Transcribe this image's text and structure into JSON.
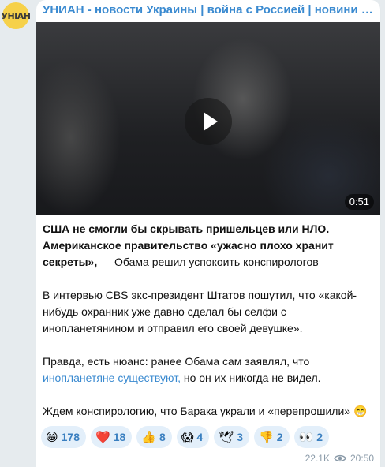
{
  "channel": {
    "title": "УНИАН - новости Украины | война с Россией | новини України...",
    "avatar_text": "УНІАН",
    "accent": "#3a8ad0"
  },
  "video": {
    "duration": "0:51"
  },
  "post": {
    "p1_bold": "США не смогли бы скрывать пришельцев или НЛО. Американское правительство «ужасно плохо хранит секреты»,",
    "p1_rest": " — Обама решил успокоить конспирологов",
    "p2": "В интервью CBS экс-президент Штатов пошутил, что «какой-нибудь охранник уже давно сделал бы селфи с инопланетянином и отправил его своей девушке».",
    "p3_start": "Правда, есть нюанс: ранее Обама сам заявлял, что ",
    "p3_link": "инопланетяне существуют,",
    "p3_end": " но он их никогда не видел.",
    "p4": "Ждем конспирологию, что Барака украли и «перепрошили» 😁"
  },
  "reactions": [
    {
      "icon": "grin-emoji",
      "emoji": "😁",
      "count": "178"
    },
    {
      "icon": "heart-emoji",
      "emoji": "❤️",
      "count": "18"
    },
    {
      "icon": "thumbs-up-emoji",
      "emoji": "👍",
      "count": "8"
    },
    {
      "icon": "scream-emoji",
      "emoji": "😱",
      "count": "4"
    },
    {
      "icon": "dove-emoji",
      "emoji": "🕊",
      "count": "3"
    },
    {
      "icon": "thumbs-down-emoji",
      "emoji": "👎",
      "count": "2"
    },
    {
      "icon": "eyes-emoji",
      "emoji": "👀",
      "count": "2"
    }
  ],
  "meta": {
    "views": "22.1K",
    "time": "20:50"
  }
}
